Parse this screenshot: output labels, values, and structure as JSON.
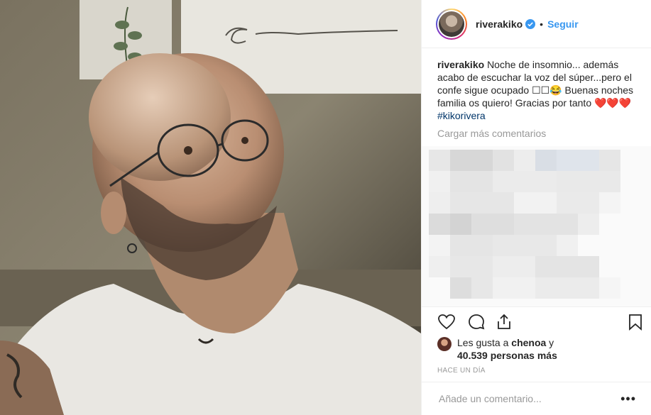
{
  "header": {
    "username": "riverakiko",
    "separator": "•",
    "follow_label": "Seguir"
  },
  "caption": {
    "username": "riverakiko",
    "text_part1": "Noche de insomnio... además acabo de escuchar la voz del súper...pero el confe sigue ocupado ☐☐😂 Buenas noches familia os quiero! Gracias por tanto",
    "hearts": "❤️❤️❤️",
    "hashtag": "#kikorivera"
  },
  "load_more_label": "Cargar más comentarios",
  "likes": {
    "prefix": "Les gusta a ",
    "liker": "chenoa",
    "connector": " y",
    "count_text": "40.539 personas más"
  },
  "timestamp": "HACE UN DÍA",
  "comment_box": {
    "placeholder": "Añade un comentario...",
    "menu_glyph": "•••"
  },
  "icons": {
    "like": "heart-icon",
    "comment": "comment-icon",
    "share": "share-icon",
    "save": "bookmark-icon",
    "verified": "verified-badge-icon"
  },
  "colors": {
    "link": "#3897f0",
    "hashtag": "#003569",
    "muted": "#999999"
  }
}
